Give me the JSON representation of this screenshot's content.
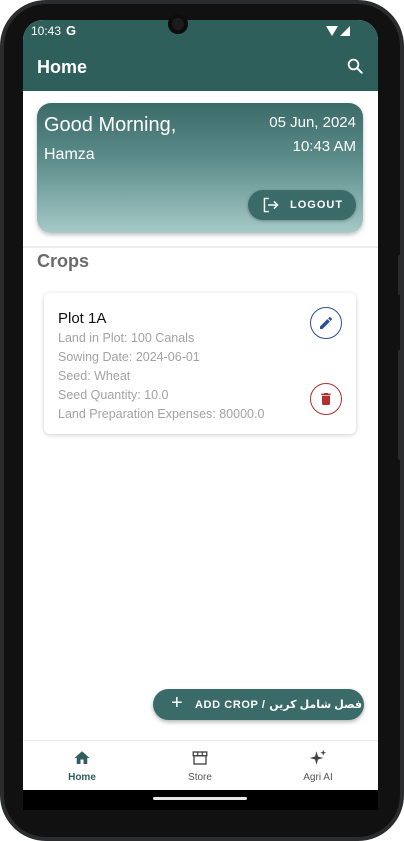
{
  "status_bar": {
    "time": "10:43",
    "google_glyph": "G"
  },
  "app_bar": {
    "title": "Home",
    "search_icon": "search-icon"
  },
  "greeting": {
    "salutation": "Good Morning,",
    "user_name": "Hamza",
    "date": "05 Jun, 2024",
    "time": "10:43 AM",
    "logout_label": "LOGOUT"
  },
  "crops": {
    "section_title": "Crops",
    "items": [
      {
        "name": "Plot 1A",
        "land_in_plot": "Land in Plot: 100 Canals",
        "sowing_date": "Sowing Date: 2024-06-01",
        "seed": "Seed: Wheat",
        "seed_quantity": "Seed Quantity: 10.0",
        "land_prep_expenses": "Land Preparation Expenses: 80000.0"
      }
    ]
  },
  "fab": {
    "label": "ADD CROP / فصل شامل کریں"
  },
  "bottom_nav": {
    "items": [
      {
        "label": "Home",
        "icon": "home-icon",
        "active": true
      },
      {
        "label": "Store",
        "icon": "store-icon",
        "active": false
      },
      {
        "label": "Agri AI",
        "icon": "sparkle-icon",
        "active": false
      }
    ]
  },
  "colors": {
    "primary": "#2f5f5b",
    "edit_accent": "#2a4f9a",
    "delete_accent": "#b23030"
  }
}
